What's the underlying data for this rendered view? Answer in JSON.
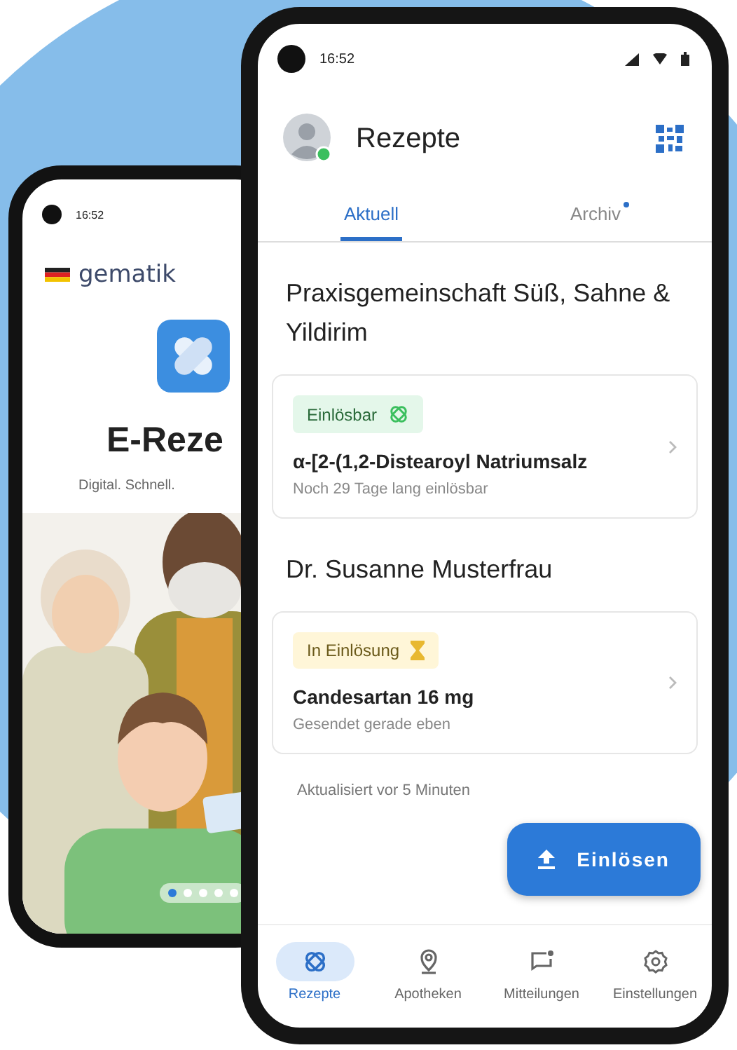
{
  "back_phone": {
    "status_time": "16:52",
    "brand": "gematik",
    "app_title": "E-Reze",
    "tagline": "Digital. Schnell.",
    "pager": [
      {
        "selected": true
      },
      {
        "selected": false
      },
      {
        "selected": false
      },
      {
        "selected": false
      },
      {
        "selected": false
      }
    ]
  },
  "front_phone": {
    "status_time": "16:52",
    "header": {
      "title": "Rezepte",
      "avatar_online": true
    },
    "tabs": [
      {
        "label": "Aktuell",
        "selected": true,
        "badge": false
      },
      {
        "label": "Archiv",
        "selected": false,
        "badge": true
      }
    ],
    "groups": [
      {
        "prescriber": "Praxisgemeinschaft Süß, Sahne & Yildirim",
        "prescriptions": [
          {
            "status": {
              "label": "Einlösbar",
              "kind": "redeemable"
            },
            "name": "α-[2-(1,2-Distearoyl Natriumsalz",
            "detail": "Noch 29 Tage lang einlösbar"
          }
        ]
      },
      {
        "prescriber": "Dr. Susanne Musterfrau",
        "prescriptions": [
          {
            "status": {
              "label": "In Einlösung",
              "kind": "pending"
            },
            "name": "Candesartan 16 mg",
            "detail": "Gesendet gerade eben"
          }
        ]
      }
    ],
    "updated": "Aktualisiert vor 5 Minuten",
    "fab": {
      "label": "Einlösen"
    },
    "nav": [
      {
        "label": "Rezepte",
        "selected": true
      },
      {
        "label": "Apotheken",
        "selected": false
      },
      {
        "label": "Mitteilungen",
        "selected": false
      },
      {
        "label": "Einstellungen",
        "selected": false
      }
    ]
  }
}
